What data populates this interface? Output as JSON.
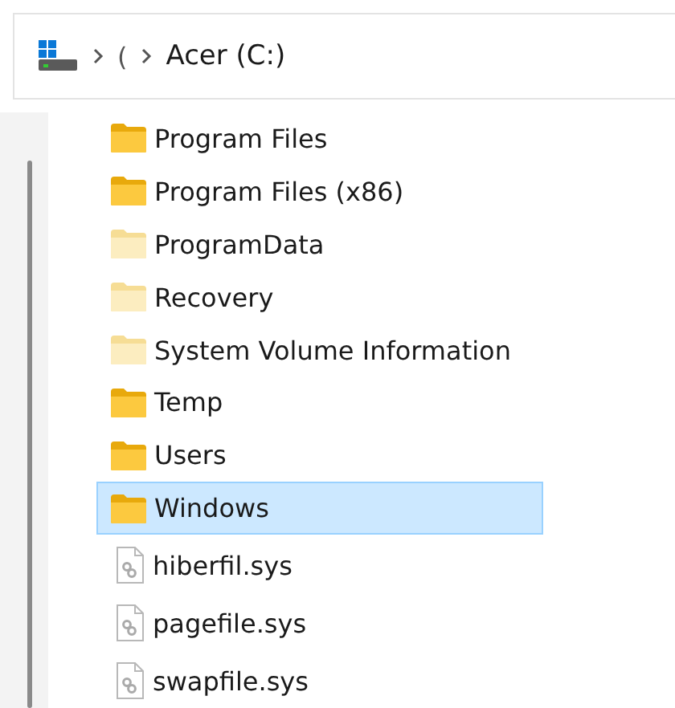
{
  "address": {
    "segments": [
      "(",
      "Acer (C:)"
    ]
  },
  "items": [
    {
      "kind": "folder",
      "name": "Program Files",
      "hidden": false,
      "selected": false
    },
    {
      "kind": "folder",
      "name": "Program Files (x86)",
      "hidden": false,
      "selected": false
    },
    {
      "kind": "folder",
      "name": "ProgramData",
      "hidden": true,
      "selected": false
    },
    {
      "kind": "folder",
      "name": "Recovery",
      "hidden": true,
      "selected": false
    },
    {
      "kind": "folder",
      "name": "System Volume Information",
      "hidden": true,
      "selected": false
    },
    {
      "kind": "folder",
      "name": "Temp",
      "hidden": false,
      "selected": false
    },
    {
      "kind": "folder",
      "name": "Users",
      "hidden": false,
      "selected": false
    },
    {
      "kind": "folder",
      "name": "Windows",
      "hidden": false,
      "selected": true
    },
    {
      "kind": "file",
      "name": "hiberfil.sys",
      "hidden": true,
      "selected": false
    },
    {
      "kind": "file",
      "name": "pagefile.sys",
      "hidden": true,
      "selected": false
    },
    {
      "kind": "file",
      "name": "swapfile.sys",
      "hidden": true,
      "selected": false
    }
  ]
}
